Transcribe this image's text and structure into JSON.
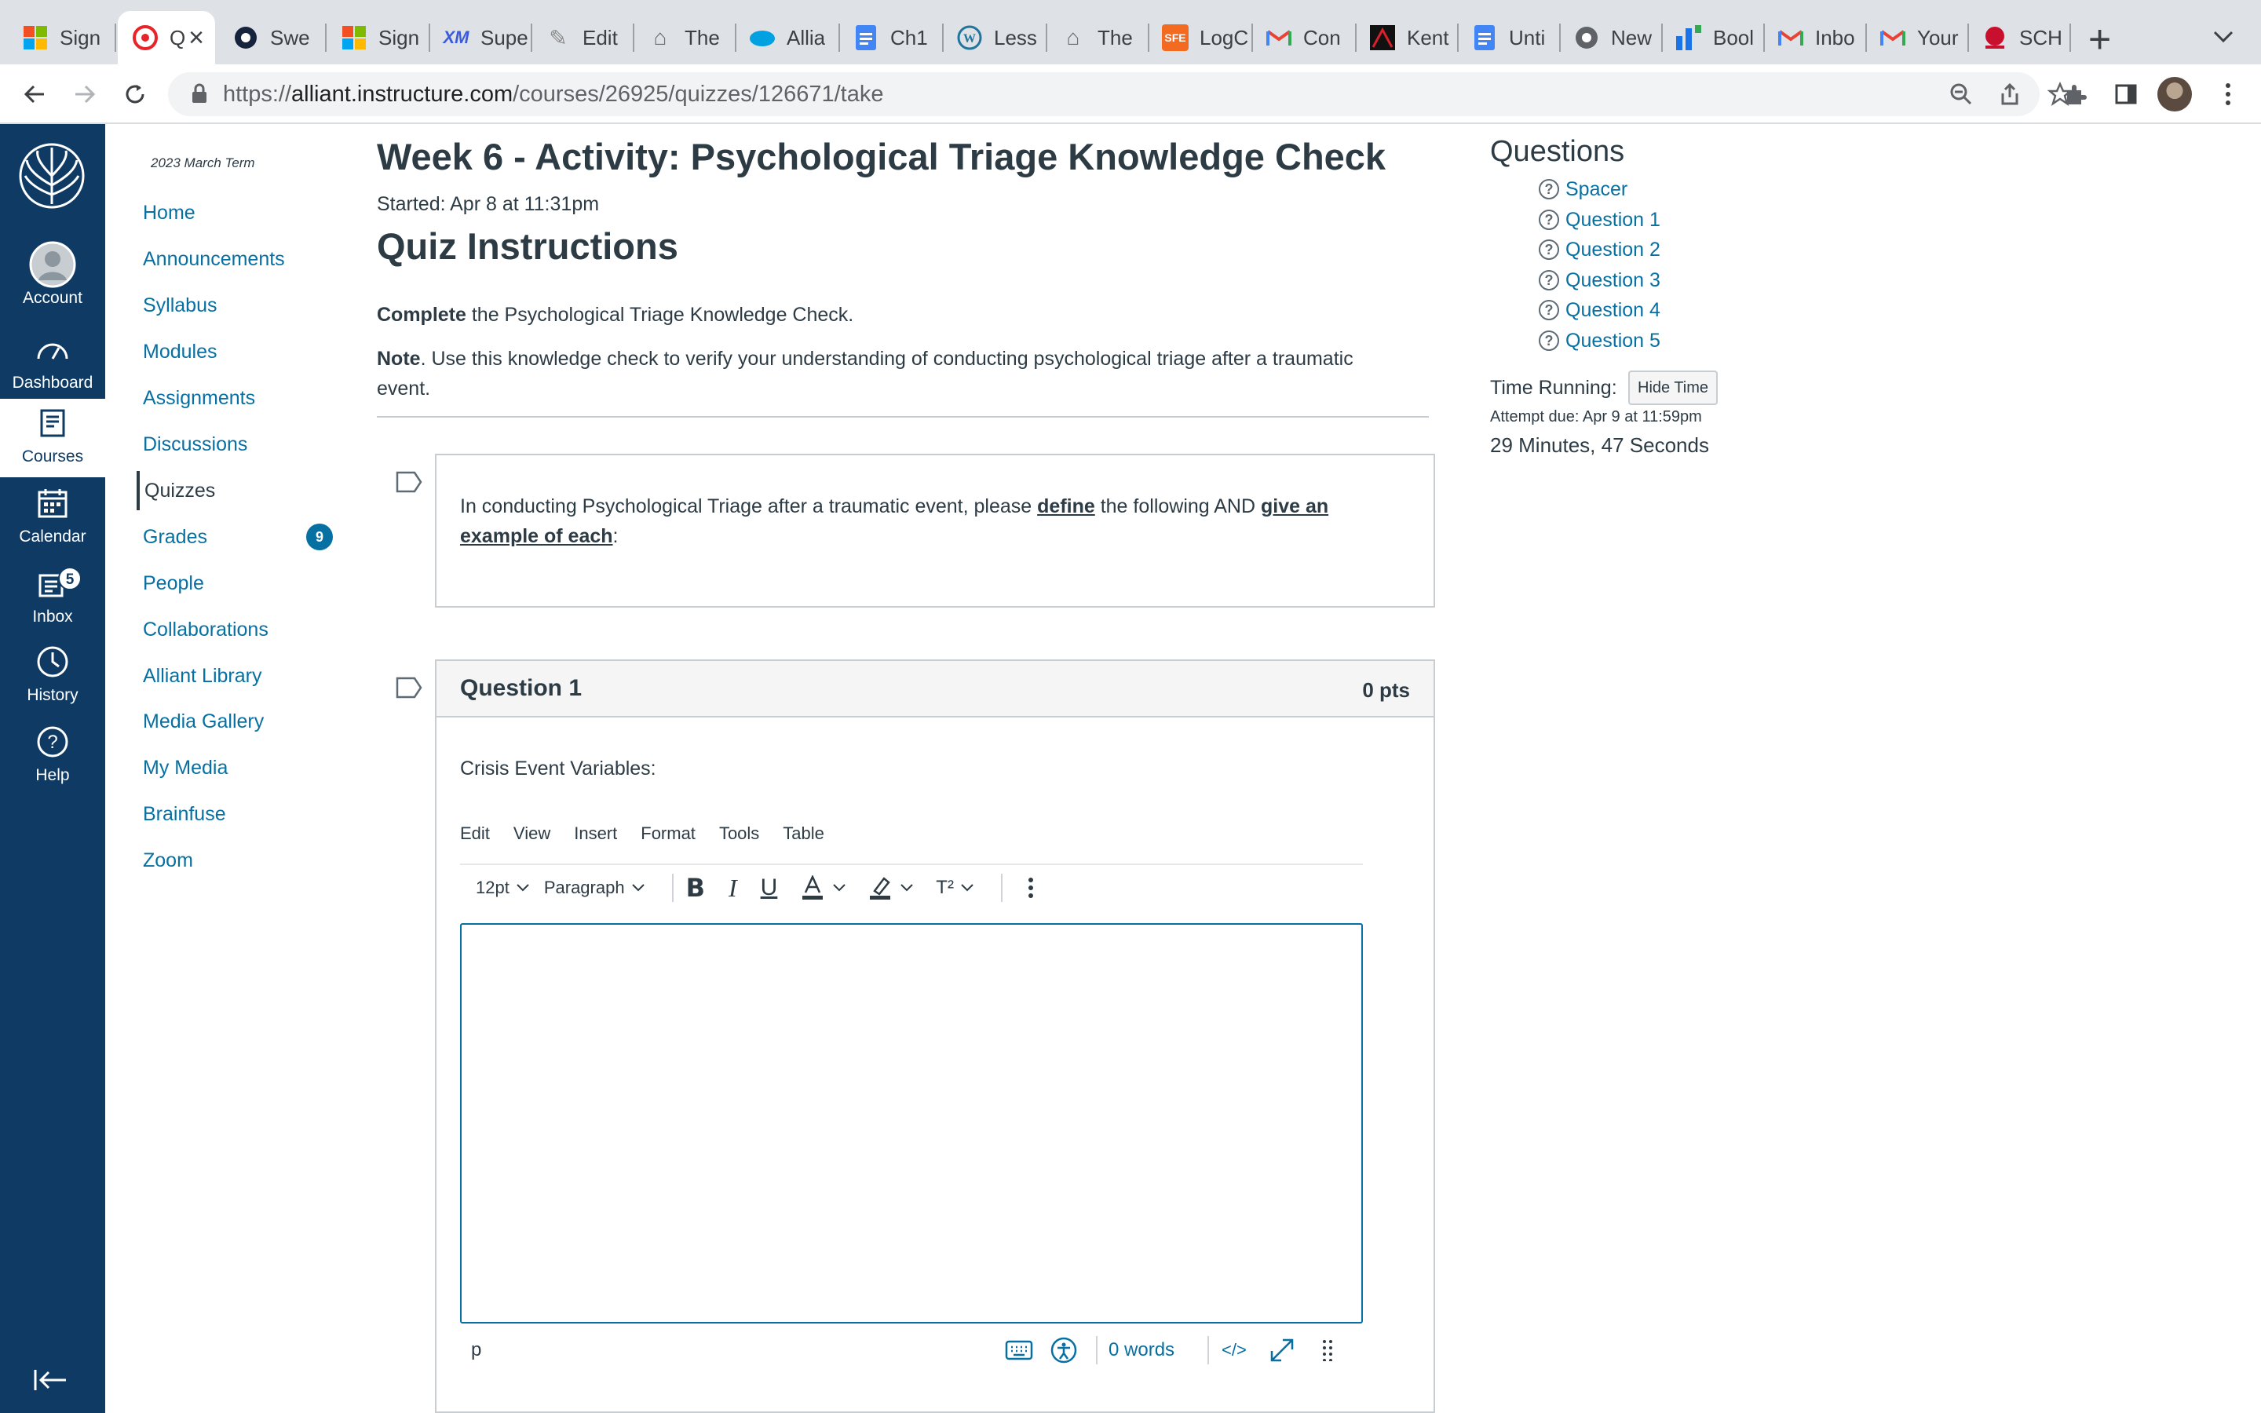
{
  "browser": {
    "tabs": [
      {
        "title": "Sign",
        "icon": "microsoft-icon"
      },
      {
        "title": "Q",
        "icon": "canvas-icon",
        "active": true
      },
      {
        "title": "Swe",
        "icon": "sweet-icon"
      },
      {
        "title": "Sign",
        "icon": "microsoft-icon"
      },
      {
        "title": "Supe",
        "icon": "xm-icon"
      },
      {
        "title": "Edit",
        "icon": "edit-icon"
      },
      {
        "title": "The",
        "icon": "building-icon"
      },
      {
        "title": "Allia",
        "icon": "salesforce-icon"
      },
      {
        "title": "Ch1",
        "icon": "docs-icon"
      },
      {
        "title": "Less",
        "icon": "wordpress-icon"
      },
      {
        "title": "The",
        "icon": "building-icon"
      },
      {
        "title": "LogC",
        "icon": "sfe-icon"
      },
      {
        "title": "Con",
        "icon": "gmail-icon"
      },
      {
        "title": "Kent",
        "icon": "kent-icon"
      },
      {
        "title": "Unti",
        "icon": "docs-icon"
      },
      {
        "title": "New",
        "icon": "chrome-icon"
      },
      {
        "title": "Bool",
        "icon": "bookings-icon"
      },
      {
        "title": "Inbo",
        "icon": "gmail-icon"
      },
      {
        "title": "Your",
        "icon": "gmail-icon"
      },
      {
        "title": "SCH",
        "icon": "school-icon"
      }
    ],
    "url_scheme": "https://",
    "url_host": "alliant.instructure.com",
    "url_path": "/courses/26925/quizzes/126671/take"
  },
  "global_nav": {
    "items": [
      {
        "label": "Account",
        "icon": "account-icon"
      },
      {
        "label": "Dashboard",
        "icon": "dashboard-icon"
      },
      {
        "label": "Courses",
        "icon": "courses-icon",
        "active": true
      },
      {
        "label": "Calendar",
        "icon": "calendar-icon"
      },
      {
        "label": "Inbox",
        "icon": "inbox-icon",
        "badge": "5"
      },
      {
        "label": "History",
        "icon": "history-icon"
      },
      {
        "label": "Help",
        "icon": "help-icon"
      }
    ]
  },
  "course_nav": {
    "term": "2023 March Term",
    "items": [
      {
        "label": "Home"
      },
      {
        "label": "Announcements"
      },
      {
        "label": "Syllabus"
      },
      {
        "label": "Modules"
      },
      {
        "label": "Assignments"
      },
      {
        "label": "Discussions"
      },
      {
        "label": "Quizzes",
        "active": true
      },
      {
        "label": "Grades",
        "badge": "9"
      },
      {
        "label": "People"
      },
      {
        "label": "Collaborations"
      },
      {
        "label": "Alliant Library"
      },
      {
        "label": "Media Gallery"
      },
      {
        "label": "My Media"
      },
      {
        "label": "Brainfuse"
      },
      {
        "label": "Zoom"
      }
    ]
  },
  "quiz": {
    "title": "Week 6 - Activity: Psychological Triage Knowledge Check",
    "started": "Started: Apr 8 at 11:31pm",
    "instructions_heading": "Quiz Instructions",
    "instr1_bold": "Complete",
    "instr1_rest": " the Psychological Triage Knowledge Check.",
    "instr2_bold": "Note",
    "instr2_rest": ". Use this knowledge check to verify your understanding of conducting psychological triage after a traumatic event.",
    "spacer_text_1": "In conducting Psychological Triage after a traumatic event, please ",
    "spacer_define": "define",
    "spacer_text_2": " the following AND ",
    "spacer_give": "give an example of each",
    "spacer_text_3": ":",
    "question1": {
      "title": "Question 1",
      "points": "0 pts",
      "prompt": "Crisis Event Variables:"
    }
  },
  "editor": {
    "menu": [
      "Edit",
      "View",
      "Insert",
      "Format",
      "Tools",
      "Table"
    ],
    "font_size": "12pt",
    "block_format": "Paragraph",
    "superscript_label": "T²",
    "status_path": "p",
    "word_count": "0 words",
    "html_toggle": "</>"
  },
  "sidebar": {
    "heading": "Questions",
    "questions": [
      "Spacer",
      "Question 1",
      "Question 2",
      "Question 3",
      "Question 4",
      "Question 5"
    ],
    "time_running_label": "Time Running:",
    "hide_time_label": "Hide Time",
    "attempt_due": "Attempt due: Apr 9 at 11:59pm",
    "time_remaining": "29 Minutes, 47 Seconds"
  },
  "colors": {
    "global_nav_bg": "#0e3a63",
    "link": "#0770a3",
    "text": "#2d3b45"
  }
}
